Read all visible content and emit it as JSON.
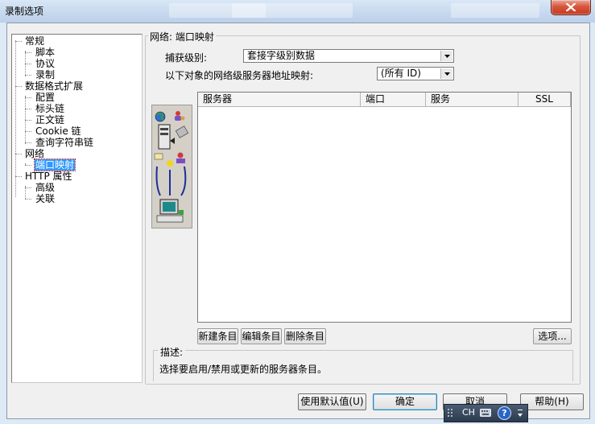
{
  "window": {
    "title": "录制选项",
    "close_icon": "close-icon"
  },
  "tree": {
    "items": [
      {
        "label": "常规",
        "level": 0
      },
      {
        "label": "脚本",
        "level": 1
      },
      {
        "label": "协议",
        "level": 1
      },
      {
        "label": "录制",
        "level": 1
      },
      {
        "label": "数据格式扩展",
        "level": 0
      },
      {
        "label": "配置",
        "level": 1
      },
      {
        "label": "标头链",
        "level": 1
      },
      {
        "label": "正文链",
        "level": 1
      },
      {
        "label": "Cookie 链",
        "level": 1
      },
      {
        "label": "查询字符串链",
        "level": 1
      },
      {
        "label": "网络",
        "level": 0
      },
      {
        "label": "端口映射",
        "level": 1,
        "selected": true
      },
      {
        "label": "HTTP 属性",
        "level": 0
      },
      {
        "label": "高级",
        "level": 1
      },
      {
        "label": "关联",
        "level": 1
      }
    ]
  },
  "panel": {
    "group_title": "网络: 端口映射",
    "capture_level_label": "捕获级别:",
    "capture_level_value": "套接字级别数据",
    "mapping_label": "以下对象的网络级服务器地址映射:",
    "mapping_value": "(所有 ID)"
  },
  "table": {
    "columns": [
      "服务器",
      "端口",
      "服务",
      "SSL"
    ],
    "rows": []
  },
  "buttons": {
    "new_entry": "新建条目",
    "edit_entry": "编辑条目",
    "delete_entry": "删除条目",
    "options": "选项..."
  },
  "description": {
    "label": "描述:",
    "text": "选择要启用/禁用或更新的服务器条目。"
  },
  "footer": {
    "use_defaults": "使用默认值(U)",
    "ok": "确定",
    "cancel": "取消",
    "help": "帮助(H)"
  },
  "ime": {
    "lang": "CH",
    "help_glyph": "?"
  },
  "colors": {
    "selection": "#3399ff",
    "title_bar": "#c6d8ee",
    "close_button": "#c73b20"
  }
}
